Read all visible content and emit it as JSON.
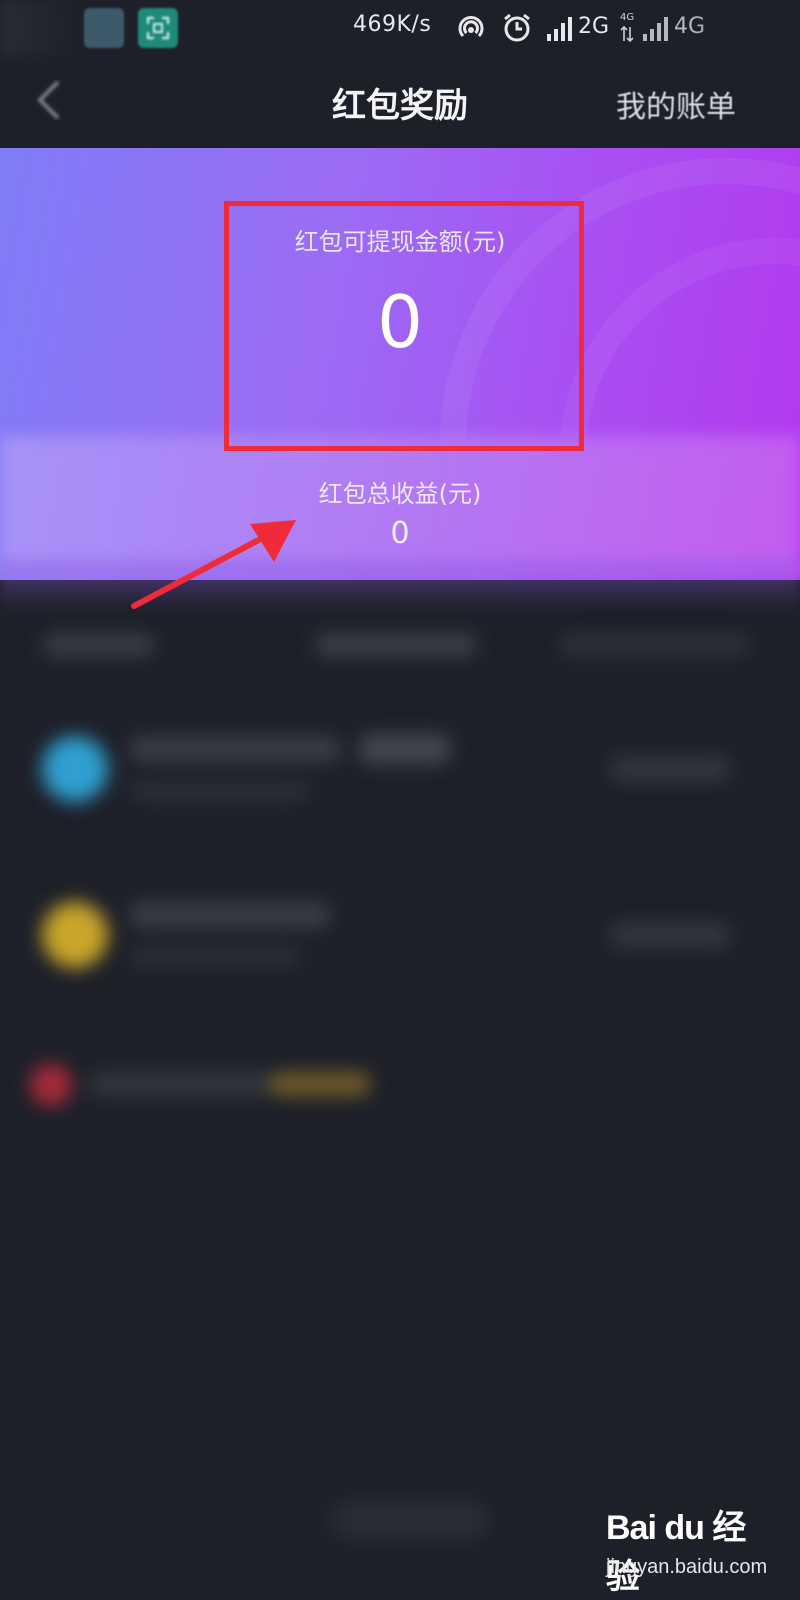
{
  "status_bar": {
    "speed": "469K/s",
    "net1": "2G",
    "net2_small": "4G",
    "net3": "4G"
  },
  "navbar": {
    "title": "红包奖励",
    "bill_link": "我的账单"
  },
  "hero": {
    "withdraw_label": "红包可提现金额(元)",
    "withdraw_amount": "0",
    "total_label": "红包总收益(元)",
    "total_amount": "0"
  },
  "colors": {
    "background": "#1e2029",
    "highlight": "#ef2b3a",
    "gradient_start": "#7f7cf6",
    "gradient_end": "#b338ef"
  },
  "watermark": {
    "brand": "Bai du 经验",
    "url": "jingyan.baidu.com"
  }
}
